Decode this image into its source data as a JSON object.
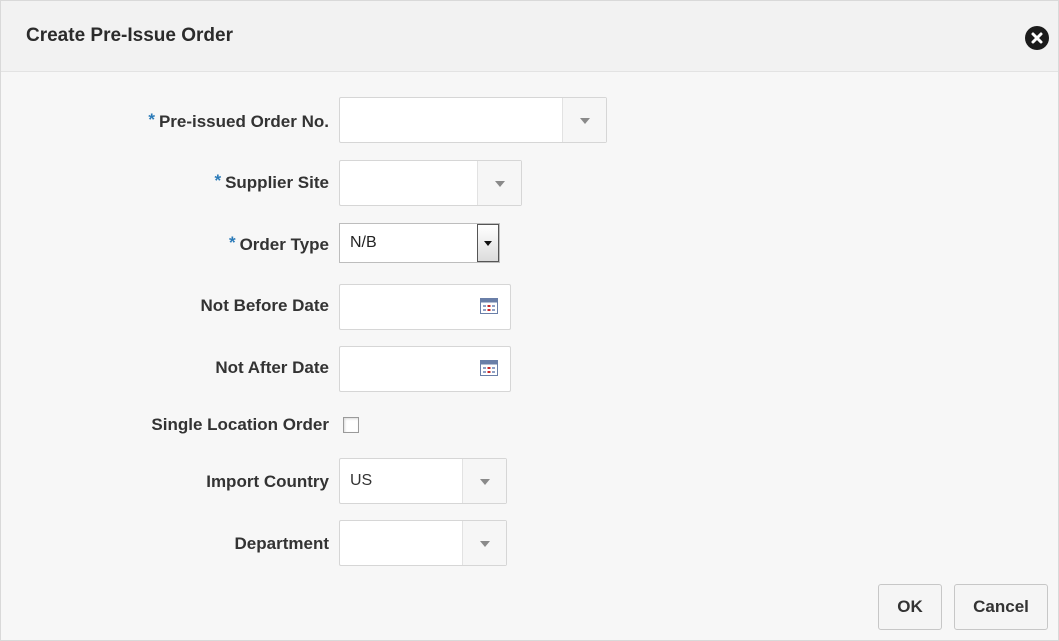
{
  "dialog": {
    "title": "Create Pre-Issue Order",
    "close_icon": "close-circle-icon"
  },
  "form": {
    "required_marker": "*",
    "pre_issued_order_no": {
      "label": "Pre-issued Order No.",
      "value": "",
      "required": true
    },
    "supplier_site": {
      "label": "Supplier Site",
      "value": "",
      "required": true
    },
    "order_type": {
      "label": "Order Type",
      "value": "N/B",
      "required": true
    },
    "not_before_date": {
      "label": "Not Before Date",
      "value": "",
      "icon": "calendar-icon"
    },
    "not_after_date": {
      "label": "Not After Date",
      "value": "",
      "icon": "calendar-icon"
    },
    "single_location_order": {
      "label": "Single Location Order",
      "checked": false
    },
    "import_country": {
      "label": "Import Country",
      "value": "US"
    },
    "department": {
      "label": "Department",
      "value": ""
    }
  },
  "buttons": {
    "ok": "OK",
    "cancel": "Cancel"
  },
  "colors": {
    "required_marker": "#2a7ab8",
    "calendar_red": "#c8282b"
  }
}
